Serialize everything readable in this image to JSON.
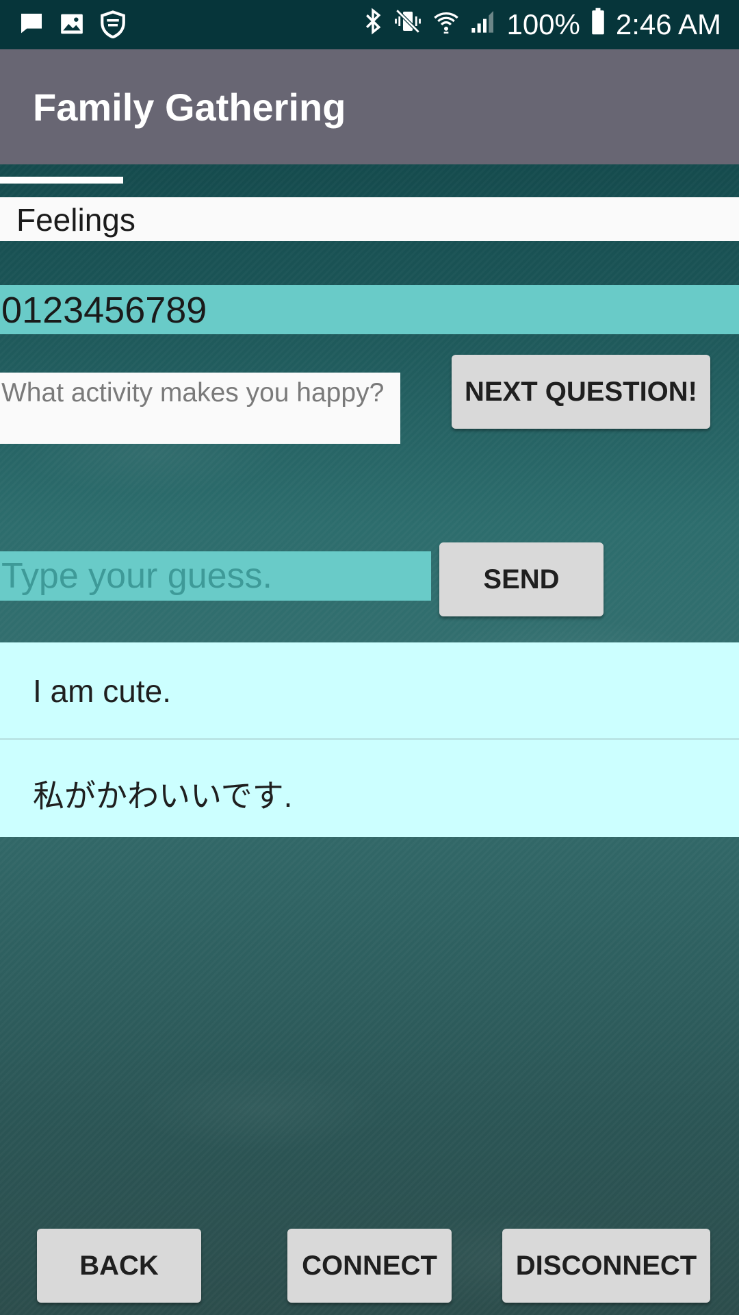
{
  "status_bar": {
    "battery": "100%",
    "time": "2:46 AM",
    "left_icons": [
      "message-icon",
      "image-icon",
      "shield-icon"
    ],
    "right_icons": [
      "bluetooth-icon",
      "vibrate-mute-icon",
      "wifi-icon",
      "signal-icon",
      "battery-icon"
    ]
  },
  "app_bar": {
    "title": "Family Gathering"
  },
  "category": "Feelings",
  "code": "0123456789",
  "question": "What activity makes you happy?",
  "buttons": {
    "next_question": "NEXT QUESTION!",
    "send": "SEND",
    "back": "BACK",
    "connect": "CONNECT",
    "disconnect": "DISCONNECT"
  },
  "guess_input": {
    "placeholder": "Type your guess.",
    "value": ""
  },
  "messages": [
    "I am cute.",
    "私がかわいいです."
  ],
  "colors": {
    "status_bar": "#06353a",
    "app_bar": "#686673",
    "teal_field": "#69cbc8",
    "message_bg": "#ccffff",
    "button_bg": "#d9d9d9"
  }
}
